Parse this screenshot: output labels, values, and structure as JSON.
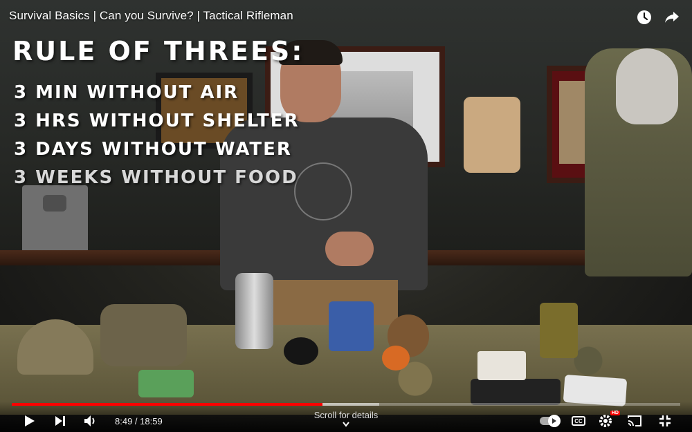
{
  "video": {
    "title": "Survival Basics | Can you Survive? | Tactical Rifleman"
  },
  "overlay": {
    "heading": "RULE OF THREES:",
    "rules": [
      "3 MIN WITHOUT AIR",
      "3 HRS WITHOUT SHELTER",
      "3 DAYS WITHOUT WATER",
      "3 WEEKS WITHOUT FOOD"
    ]
  },
  "player": {
    "current_time": "8:49",
    "duration": "18:59",
    "time_display": "8:49 / 18:59",
    "played_fraction": 0.465,
    "loaded_fraction": 0.55,
    "scroll_hint": "Scroll for details",
    "quality_badge": "HD",
    "colors": {
      "progress_played": "#ff0000",
      "accent": "#ffffff"
    },
    "icons": {
      "watch_later": "clock-icon",
      "share": "share-icon",
      "play": "play-icon",
      "next": "next-icon",
      "volume": "volume-icon",
      "autoplay": "autoplay-toggle",
      "captions": "cc-icon",
      "settings": "gear-icon",
      "cast": "cast-icon",
      "fullscreen": "exit-fullscreen-icon"
    }
  }
}
